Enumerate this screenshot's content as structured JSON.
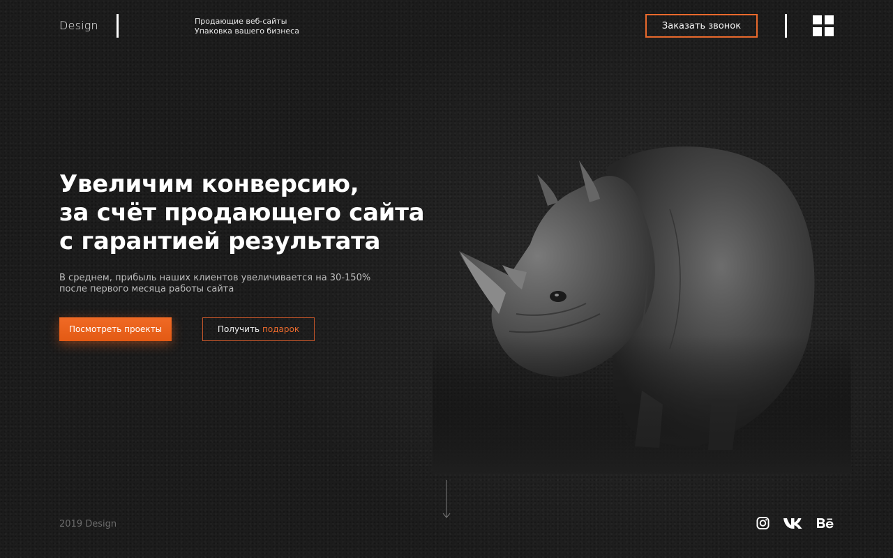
{
  "header": {
    "logo": "Design",
    "tagline_line1": "Продающие веб-сайты",
    "tagline_line2": "Упаковка вашего бизнеса",
    "call_button": "Заказать звонок",
    "menu_icon": "grid-menu-icon"
  },
  "hero": {
    "title_line1": "Увеличим конверсию,",
    "title_line2": "за счёт продающего сайта",
    "title_line3": "с гарантией результата",
    "subtitle_line1": "В среднем, прибыль наших клиентов увеличивается на 30-150%",
    "subtitle_line2": "после первого месяца работы сайта",
    "primary_button": "Посмотреть проекты",
    "secondary_button_text": "Получить",
    "secondary_button_accent": "подарок"
  },
  "footer": {
    "copyright": "2019 Design",
    "social": [
      "instagram-icon",
      "vk-icon",
      "behance-icon"
    ]
  },
  "colors": {
    "accent": "#e9692c",
    "background": "#1f1f1f",
    "text": "#ffffff"
  }
}
